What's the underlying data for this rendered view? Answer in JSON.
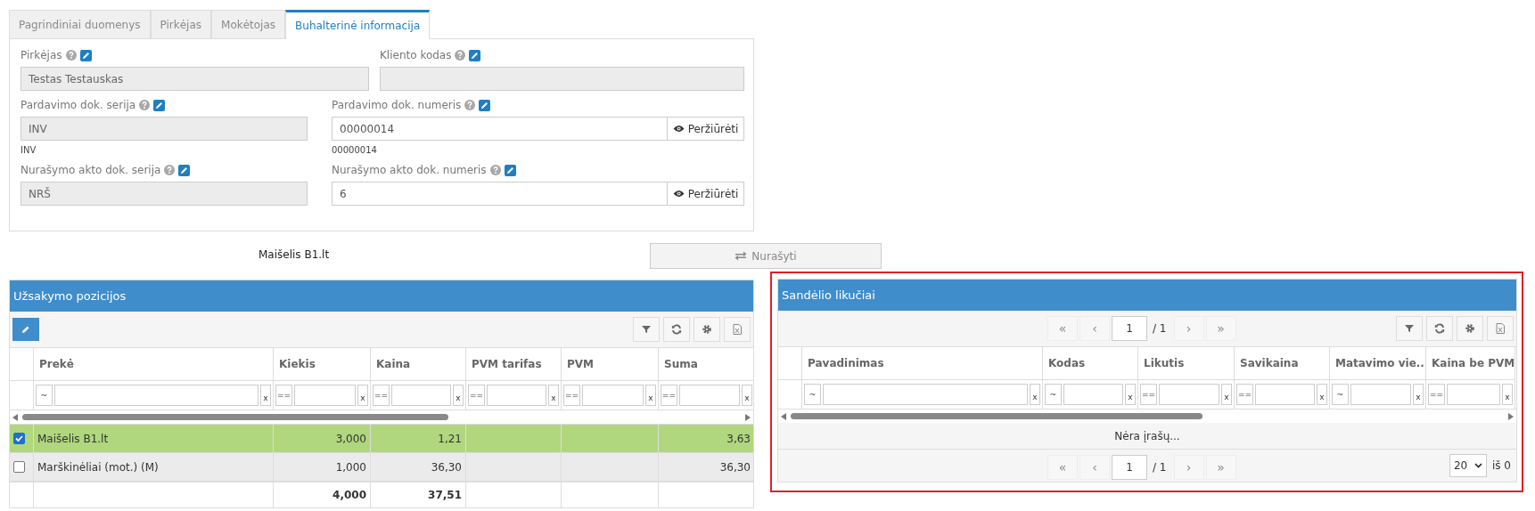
{
  "tabs": [
    {
      "label": "Pagrindiniai duomenys",
      "selected": false
    },
    {
      "label": "Pirkėjas",
      "selected": false
    },
    {
      "label": "Mokėtojas",
      "selected": false
    },
    {
      "label": "Buhalterinė informacija",
      "selected": true
    }
  ],
  "form": {
    "rows": [
      {
        "fields": [
          {
            "label": "Pirkėjas",
            "value": "Testas Testauskas",
            "readonly": true
          },
          {
            "label": "Kliento kodas",
            "readonly": true
          }
        ]
      },
      {
        "fields": [
          {
            "label": "Pardavimo dok. serija",
            "value": "INV",
            "readonly": true,
            "hint": "INV"
          },
          {
            "label": "Pardavimo dok. numeris",
            "value": "00000014",
            "readonly": false,
            "hint": "00000014",
            "action": "Peržiūrėti"
          }
        ]
      },
      {
        "fields": [
          {
            "label": "Nurašymo akto dok. serija",
            "value": "NRŠ",
            "readonly": true
          },
          {
            "label": "Nurašymo akto dok. numeris",
            "value": "6",
            "readonly": false,
            "action": "Peržiūrėti"
          }
        ]
      }
    ]
  },
  "selected_item_label": "Maišelis B1.lt",
  "write_off_button": {
    "label": "Nurašyti",
    "disabled": true
  },
  "order_items": {
    "title": "Užsakymo pozicijos",
    "columns": [
      {
        "label": "Prekė",
        "filter": {
          "op": "~",
          "clear": "x"
        }
      },
      {
        "label": "Kiekis",
        "filter": {
          "op": "==",
          "clear": "x"
        }
      },
      {
        "label": "Kaina",
        "filter": {
          "op": "==",
          "clear": "x"
        }
      },
      {
        "label": "PVM tarifas",
        "filter": {
          "op": "==",
          "clear": "x"
        }
      },
      {
        "label": "PVM",
        "filter": {
          "op": "==",
          "clear": "x"
        }
      },
      {
        "label": "Suma",
        "filter": {
          "op": "==",
          "clear": "x"
        }
      }
    ],
    "rows": [
      {
        "selected": true,
        "product": "Maišelis B1.lt",
        "quantity": "3,000",
        "price": "1,21",
        "sum": "3,63"
      },
      {
        "selected": false,
        "product": "Marškinėliai (mot.) (M)",
        "quantity": "1,000",
        "price": "36,30",
        "sum": "36,30"
      }
    ],
    "totals": {
      "quantity": "4,000",
      "price": "37,51"
    }
  },
  "stock": {
    "title": "Sandėlio likučiai",
    "highlighted": true,
    "pager_top": {
      "first": "«",
      "prev": "‹",
      "page": "1",
      "of": "/ 1",
      "next": "›",
      "last": "»"
    },
    "columns": [
      {
        "label": "Pavadinimas",
        "filter": {
          "op": "~",
          "clear": "x"
        }
      },
      {
        "label": "Kodas",
        "filter": {
          "op": "~",
          "clear": "x"
        }
      },
      {
        "label": "Likutis",
        "filter": {
          "op": "==",
          "clear": "x"
        }
      },
      {
        "label": "Savikaina",
        "filter": {
          "op": "==",
          "clear": "x"
        }
      },
      {
        "label": "Matavimo vie...",
        "filter": {
          "op": "~",
          "clear": "x"
        }
      },
      {
        "label": "Kaina be PVM",
        "filter": {
          "op": "==",
          "clear": "x"
        }
      }
    ],
    "empty_message": "Nėra įrašų...",
    "pager_bottom": {
      "first": "«",
      "prev": "‹",
      "page": "1",
      "of": "/ 1",
      "next": "›",
      "last": "»",
      "page_size": "20",
      "count": "iš 0"
    }
  }
}
